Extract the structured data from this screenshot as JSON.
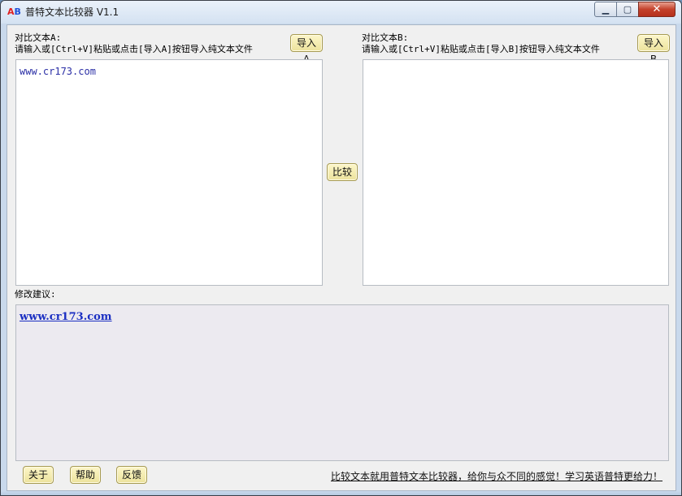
{
  "window": {
    "icon_a": "A",
    "icon_b": "B",
    "title": "普特文本比较器 V1.1",
    "min_glyph": "▁",
    "max_glyph": "▢",
    "close_glyph": "✕"
  },
  "panel_a": {
    "label": "对比文本A:",
    "hint": "请输入或[Ctrl+V]粘贴或点击[导入A]按钮导入纯文本文件",
    "import_label": "导入A",
    "content": "www.cr173.com"
  },
  "panel_b": {
    "label": "对比文本B:",
    "hint": "请输入或[Ctrl+V]粘贴或点击[导入B]按钮导入纯文本文件",
    "import_label": "导入B",
    "content": ""
  },
  "compare_label": "比较",
  "suggestion": {
    "label": "修改建议:",
    "content": "www.cr173.com"
  },
  "footer": {
    "about_label": "关于",
    "help_label": "帮助",
    "feedback_label": "反馈",
    "slogan": "比较文本就用普特文本比较器，给你与众不同的感觉！学习英语普特更给力！"
  },
  "colors": {
    "button_fill": "#f2e9ad",
    "link_blue": "#1b2fc2",
    "close_red": "#c4412b"
  }
}
